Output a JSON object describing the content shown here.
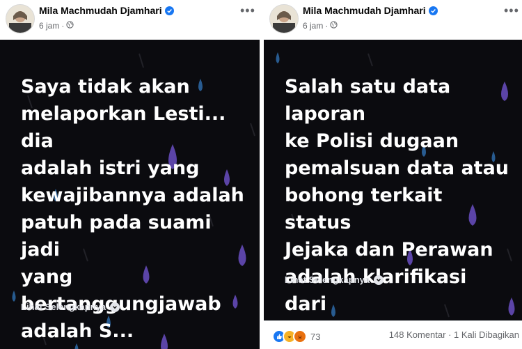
{
  "posts": [
    {
      "author": "Mila Machmudah Djamhari",
      "time": "6 jam",
      "separator": "·",
      "text": "Saya tidak akan\nmelaporkan Lesti... dia\nadalah istri yang\nkewajibannya adalah\npatuh pada suami jadi\nyang\nbertanggungjawab\nadalah S...",
      "see_more": "Lihat Selengkapnya"
    },
    {
      "author": "Mila Machmudah Djamhari",
      "time": "6 jam",
      "separator": "·",
      "text": "Salah satu data laporan\nke Polisi dugaan\npemalsuan data atau\nbohong terkait status\nJejaka dan Perawan\nadalah klarifikasi dari\npiha...",
      "see_more": "Lihat Selengkapnya",
      "footer": {
        "reaction_count": "73",
        "comments": "148 Komentar",
        "dot": "·",
        "shares": "1 Kali Dibagikan"
      }
    }
  ],
  "icons": {
    "verified": "verified-badge-icon",
    "privacy": "globe-icon",
    "more": "more-options-icon",
    "see_more": "chevron-down-icon",
    "reactions": [
      "like-icon",
      "haha-icon",
      "angry-icon"
    ]
  },
  "colors": {
    "post_background": "#0b0b0f",
    "post_text": "#ffffff",
    "accent": "#1877f2",
    "raindrop_blue": "#2f6fb0",
    "raindrop_purple": "#6a4fc2"
  }
}
